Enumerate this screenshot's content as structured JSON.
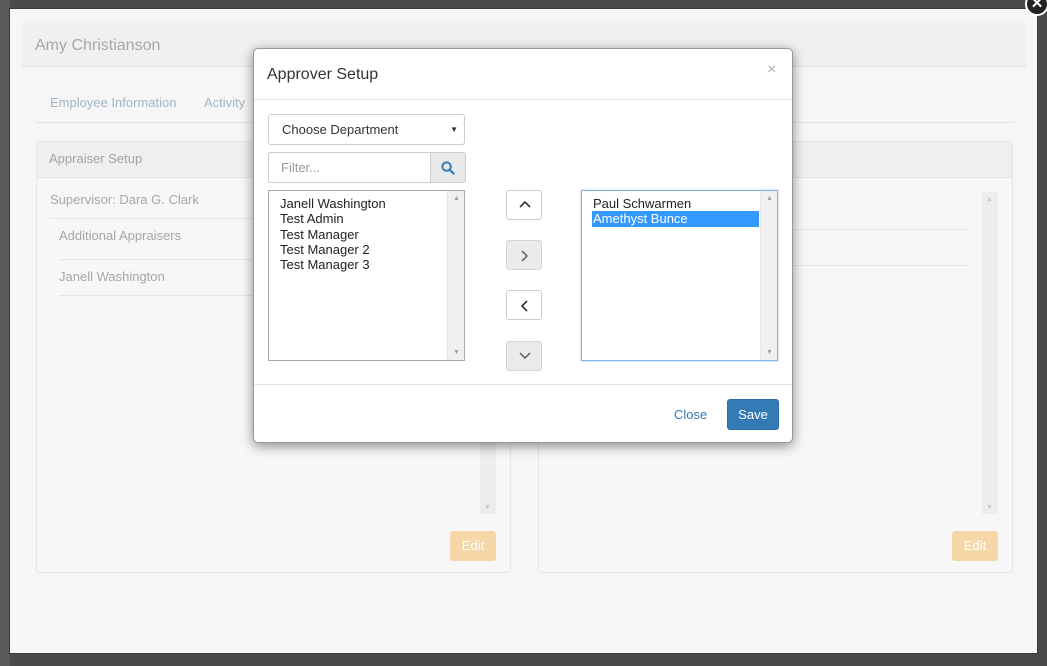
{
  "outer": {
    "employee_name": "Amy Christianson",
    "tabs": [
      "Employee Information",
      "Activity"
    ],
    "left_panel": {
      "title": "Appraiser Setup",
      "supervisor": "Supervisor: Dara G. Clark",
      "additional_label": "Additional Appraisers",
      "appraiser": "Janell Washington",
      "edit_label": "Edit"
    },
    "right_panel": {
      "edit_label": "Edit"
    }
  },
  "dialog": {
    "title": "Approver Setup",
    "close_x": "×",
    "department_select": "Choose Department",
    "filter_placeholder": "Filter...",
    "available": [
      "Janell Washington",
      "Test Admin",
      "Test Manager",
      "Test Manager 2",
      "Test Manager 3"
    ],
    "selected": [
      "Paul Schwarmen",
      "Amethyst Bunce"
    ],
    "selected_highlight": "Amethyst Bunce",
    "close_label": "Close",
    "save_label": "Save"
  },
  "icons": {
    "outer_close": "close-icon",
    "filter": "search-icon",
    "move_up": "chevron-up-icon",
    "move_right": "chevron-right-icon",
    "move_left": "chevron-left-icon",
    "move_down": "chevron-down-icon"
  },
  "colors": {
    "primary": "#337ab7",
    "selection": "#3399ff",
    "edit_disabled": "#f6d7a8"
  }
}
